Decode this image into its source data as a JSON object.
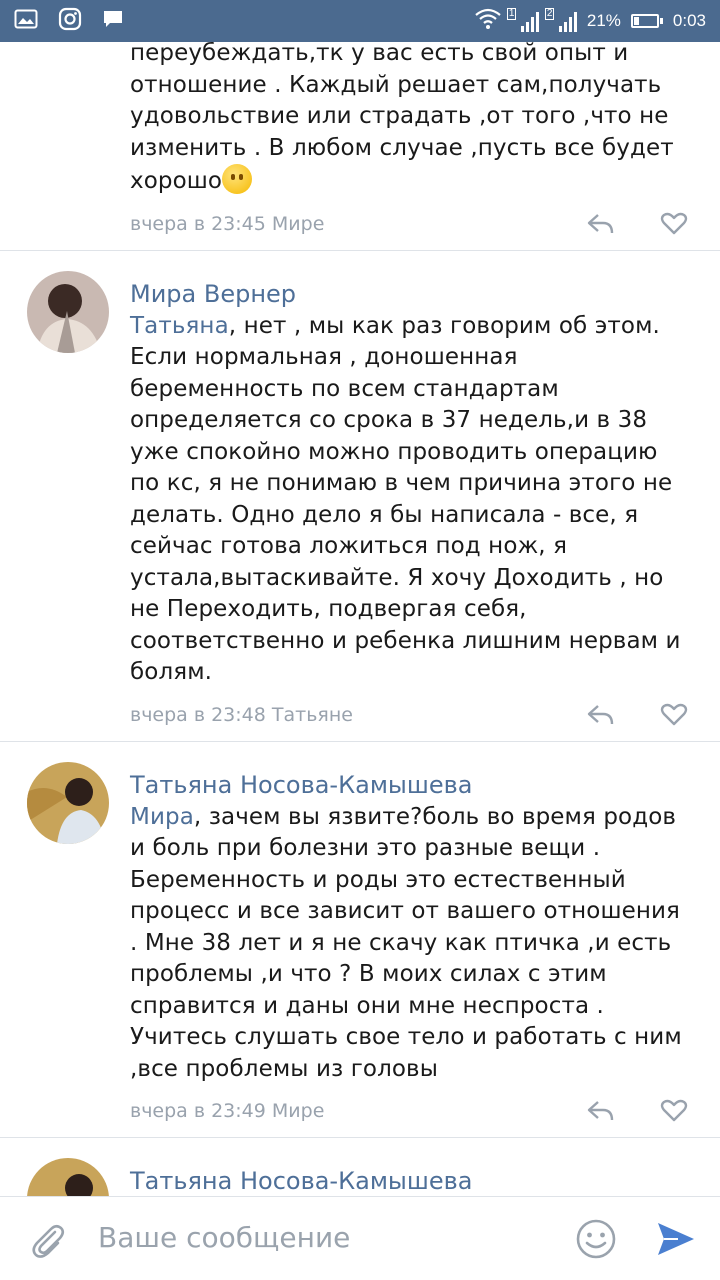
{
  "status_bar": {
    "sim1_label": "1",
    "sim2_label": "2",
    "battery_percent_text": "21%",
    "battery_level": 0.21,
    "time": "0:03",
    "icons": [
      "gallery-icon",
      "instagram-icon",
      "message-icon",
      "wifi-icon",
      "signal-icon",
      "battery-icon"
    ]
  },
  "comments": [
    {
      "author": "",
      "mention": "",
      "text_before_emoji": "переубеждать,тк у вас есть свой опыт и отношение . Каждый решает сам,получать удовольствие или страдать ,от того ,что не изменить . В любом случае ,пусть все будет хорошо",
      "emoji": "smile-emoji",
      "meta": "вчера в 23:45 Мире"
    },
    {
      "author": "Мира Вернер",
      "mention": "Татьяна",
      "text": ", нет , мы как раз говорим об этом. Если нормальная , доношенная беременность по всем стандартам определяется со срока в 37 недель,и в 38 уже спокойно можно проводить операцию по кс, я не понимаю в чем причина этого не делать. Одно дело я бы написала - все, я сейчас готова ложиться под нож, я устала,вытаскивайте. Я хочу Доходить , но не Переходить, подвергая себя, соответственно и ребенка лишним нервам и болям.",
      "meta": "вчера в 23:48 Татьяне"
    },
    {
      "author": "Татьяна Носова-Камышева",
      "mention": "Мира",
      "text": ", зачем вы язвите?боль во время родов и боль при болезни это разные вещи . Беременность и роды это естественный процесс и все зависит от вашего отношения . Мне 38 лет и я не скачу как птичка ,и есть проблемы ,и что ? В моих силах с этим справится и даны они мне неспроста . Учитесь слушать свое тело и работать с ним ,все проблемы из головы",
      "meta": "вчера в 23:49 Мире"
    },
    {
      "author": "Татьяна Носова-Камышева"
    }
  ],
  "composer": {
    "placeholder": "Ваше сообщение",
    "accent_color": "#4a7fd0"
  },
  "colors": {
    "status_bar": "#4b6a8f",
    "author_link": "#4e6f98",
    "meta_text": "#99a2ad"
  }
}
